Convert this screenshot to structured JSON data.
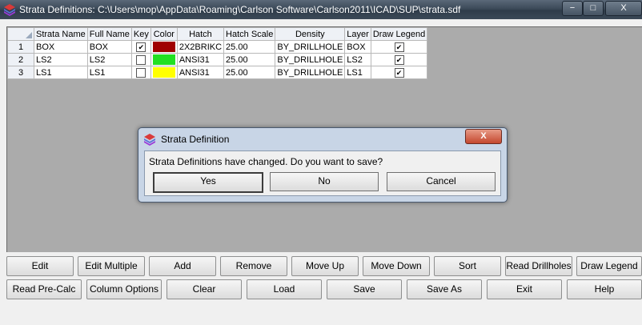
{
  "window": {
    "title": "Strata Definitions: C:\\Users\\mop\\AppData\\Roaming\\Carlson Software\\Carlson2011\\ICAD\\SUP\\strata.sdf",
    "min_glyph": "−",
    "max_glyph": "□",
    "close_glyph": "X"
  },
  "grid": {
    "columns": [
      "Strata Name",
      "Full Name",
      "Key",
      "Color",
      "Hatch",
      "Hatch Scale",
      "Density",
      "Layer",
      "Draw Legend"
    ],
    "rows": [
      {
        "num": "1",
        "strata_name": "BOX",
        "full_name": "BOX",
        "key": true,
        "color": "#a00000",
        "hatch": "2X2BRIKC",
        "hatch_scale": "25.00",
        "density": "BY_DRILLHOLE",
        "layer": "BOX",
        "draw_legend": true
      },
      {
        "num": "2",
        "strata_name": "LS2",
        "full_name": "LS2",
        "key": false,
        "color": "#22e022",
        "hatch": "ANSI31",
        "hatch_scale": "25.00",
        "density": "BY_DRILLHOLE",
        "layer": "LS2",
        "draw_legend": true
      },
      {
        "num": "3",
        "strata_name": "LS1",
        "full_name": "LS1",
        "key": false,
        "color": "#ffff00",
        "hatch": "ANSI31",
        "hatch_scale": "25.00",
        "density": "BY_DRILLHOLE",
        "layer": "LS1",
        "draw_legend": true
      }
    ]
  },
  "dialog": {
    "title": "Strata Definition",
    "message": "Strata Definitions have changed. Do you want to save?",
    "yes_label": "Yes",
    "no_label": "No",
    "cancel_label": "Cancel",
    "close_glyph": "X"
  },
  "buttons": {
    "edit": "Edit",
    "edit_multiple": "Edit Multiple",
    "add": "Add",
    "remove": "Remove",
    "move_up": "Move Up",
    "move_down": "Move Down",
    "sort": "Sort",
    "read_drillholes": "Read Drillholes",
    "draw_legend": "Draw Legend",
    "read_precalc": "Read Pre-Calc",
    "column_options": "Column Options",
    "clear": "Clear",
    "load": "Load",
    "save": "Save",
    "save_as": "Save As",
    "exit": "Exit",
    "help": "Help"
  },
  "icons": {
    "app": "strata-layers-icon",
    "dialog": "strata-layers-icon",
    "checkmark": "✔"
  }
}
